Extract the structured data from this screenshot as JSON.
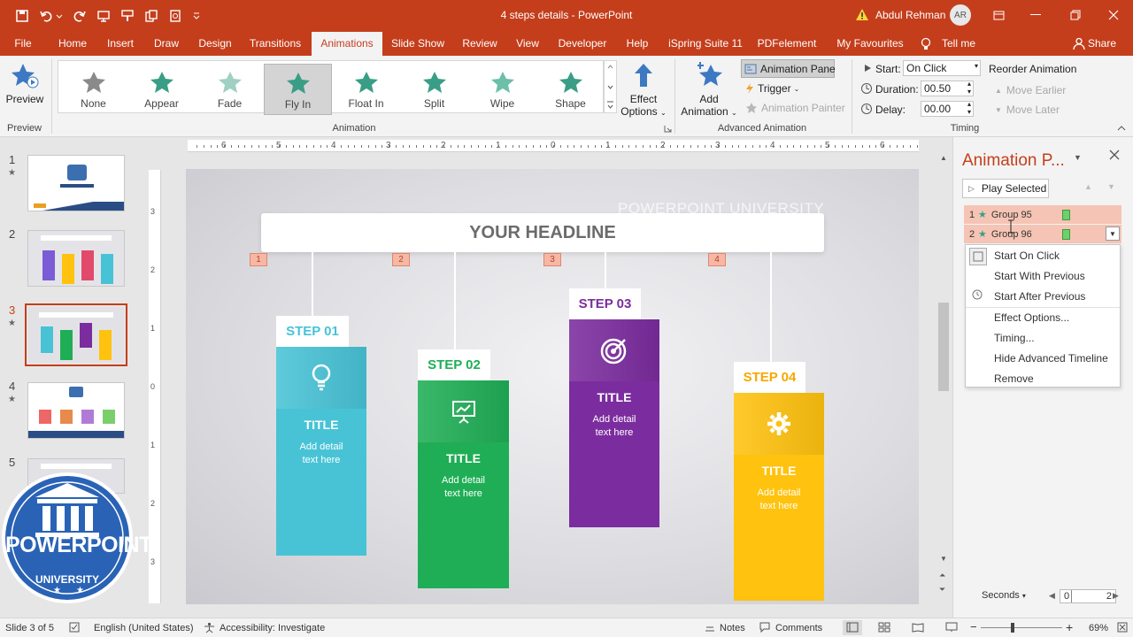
{
  "window": {
    "title": "4 steps details  -  PowerPoint",
    "user_name": "Abdul Rehman",
    "user_initials": "AR",
    "warning_icon": "warning-icon"
  },
  "tabs": [
    "File",
    "Home",
    "Insert",
    "Draw",
    "Design",
    "Transitions",
    "Animations",
    "Slide Show",
    "Review",
    "View",
    "Developer",
    "Help",
    "iSpring Suite 11",
    "PDFelement",
    "My Favourites",
    "Tell me"
  ],
  "share_label": "Share",
  "ribbon": {
    "preview": {
      "label": "Preview",
      "group": "Preview"
    },
    "animations": [
      {
        "label": "None",
        "color": "#8a8a8a"
      },
      {
        "label": "Appear",
        "color": "#3a9e86"
      },
      {
        "label": "Fade",
        "color": "#9fd0c2"
      },
      {
        "label": "Fly In",
        "color": "#3a9e86"
      },
      {
        "label": "Float In",
        "color": "#3a9e86"
      },
      {
        "label": "Split",
        "color": "#3a9e86"
      },
      {
        "label": "Wipe",
        "color": "#6cbfa8"
      },
      {
        "label": "Shape",
        "color": "#3a9e86"
      }
    ],
    "selected_animation": "Fly In",
    "animation_group": "Animation",
    "effect_options": [
      "Effect",
      "Options"
    ],
    "add_animation": [
      "Add",
      "Animation"
    ],
    "animation_pane_btn": "Animation Pane",
    "trigger": "Trigger",
    "animation_painter": "Animation Painter",
    "advanced_group": "Advanced Animation",
    "start_label": "Start:",
    "start_value": "On Click",
    "duration_label": "Duration:",
    "duration_value": "00.50",
    "delay_label": "Delay:",
    "delay_value": "00.00",
    "reorder": "Reorder Animation",
    "move_earlier": "Move Earlier",
    "move_later": "Move Later",
    "timing_group": "Timing"
  },
  "thumbnails": [
    "1",
    "2",
    "3",
    "4",
    "5"
  ],
  "ruler": {
    "h_labels": [
      "6",
      "5",
      "4",
      "3",
      "2",
      "1",
      "0",
      "1",
      "2",
      "3",
      "4",
      "5",
      "6"
    ],
    "v_labels": [
      "3",
      "2",
      "1",
      "0",
      "1",
      "2",
      "3"
    ]
  },
  "slide": {
    "watermark": "POWERPOINT UNIVERSITY",
    "headline": "YOUR HEADLINE",
    "steps": [
      {
        "marker": "1",
        "label": "STEP 01",
        "title": "TITLE",
        "detail1": "Add detail",
        "detail2": "text here",
        "color": "#48c3d6",
        "icon": "lightbulb-icon"
      },
      {
        "marker": "2",
        "label": "STEP 02",
        "title": "TITLE",
        "detail1": "Add detail",
        "detail2": "text here",
        "color": "#1fae56",
        "icon": "presentation-icon"
      },
      {
        "marker": "3",
        "label": "STEP 03",
        "title": "TITLE",
        "detail1": "Add detail",
        "detail2": "text here",
        "color": "#7b2c9e",
        "icon": "target-icon"
      },
      {
        "marker": "4",
        "label": "STEP 04",
        "title": "TITLE",
        "detail1": "Add detail",
        "detail2": "text here",
        "color": "#ffc20e",
        "icon": "gear-icon"
      }
    ]
  },
  "animation_pane": {
    "title": "Animation P...",
    "play_selected": "Play Selected",
    "items": [
      {
        "index": "1",
        "name": "Group 95"
      },
      {
        "index": "2",
        "name": "Group 96"
      }
    ],
    "menu": [
      "Start On Click",
      "Start With Previous",
      "Start After Previous",
      "Effect Options...",
      "Timing...",
      "Hide Advanced Timeline",
      "Remove"
    ],
    "seconds_label": "Seconds",
    "timeline_start": "0",
    "timeline_end": "2"
  },
  "logo": {
    "line1": "POWERPOINT",
    "line2": "UNIVERSITY"
  },
  "status": {
    "slide": "Slide 3 of 5",
    "language": "English (United States)",
    "accessibility": "Accessibility: Investigate",
    "notes": "Notes",
    "comments": "Comments",
    "zoom": "69%"
  }
}
